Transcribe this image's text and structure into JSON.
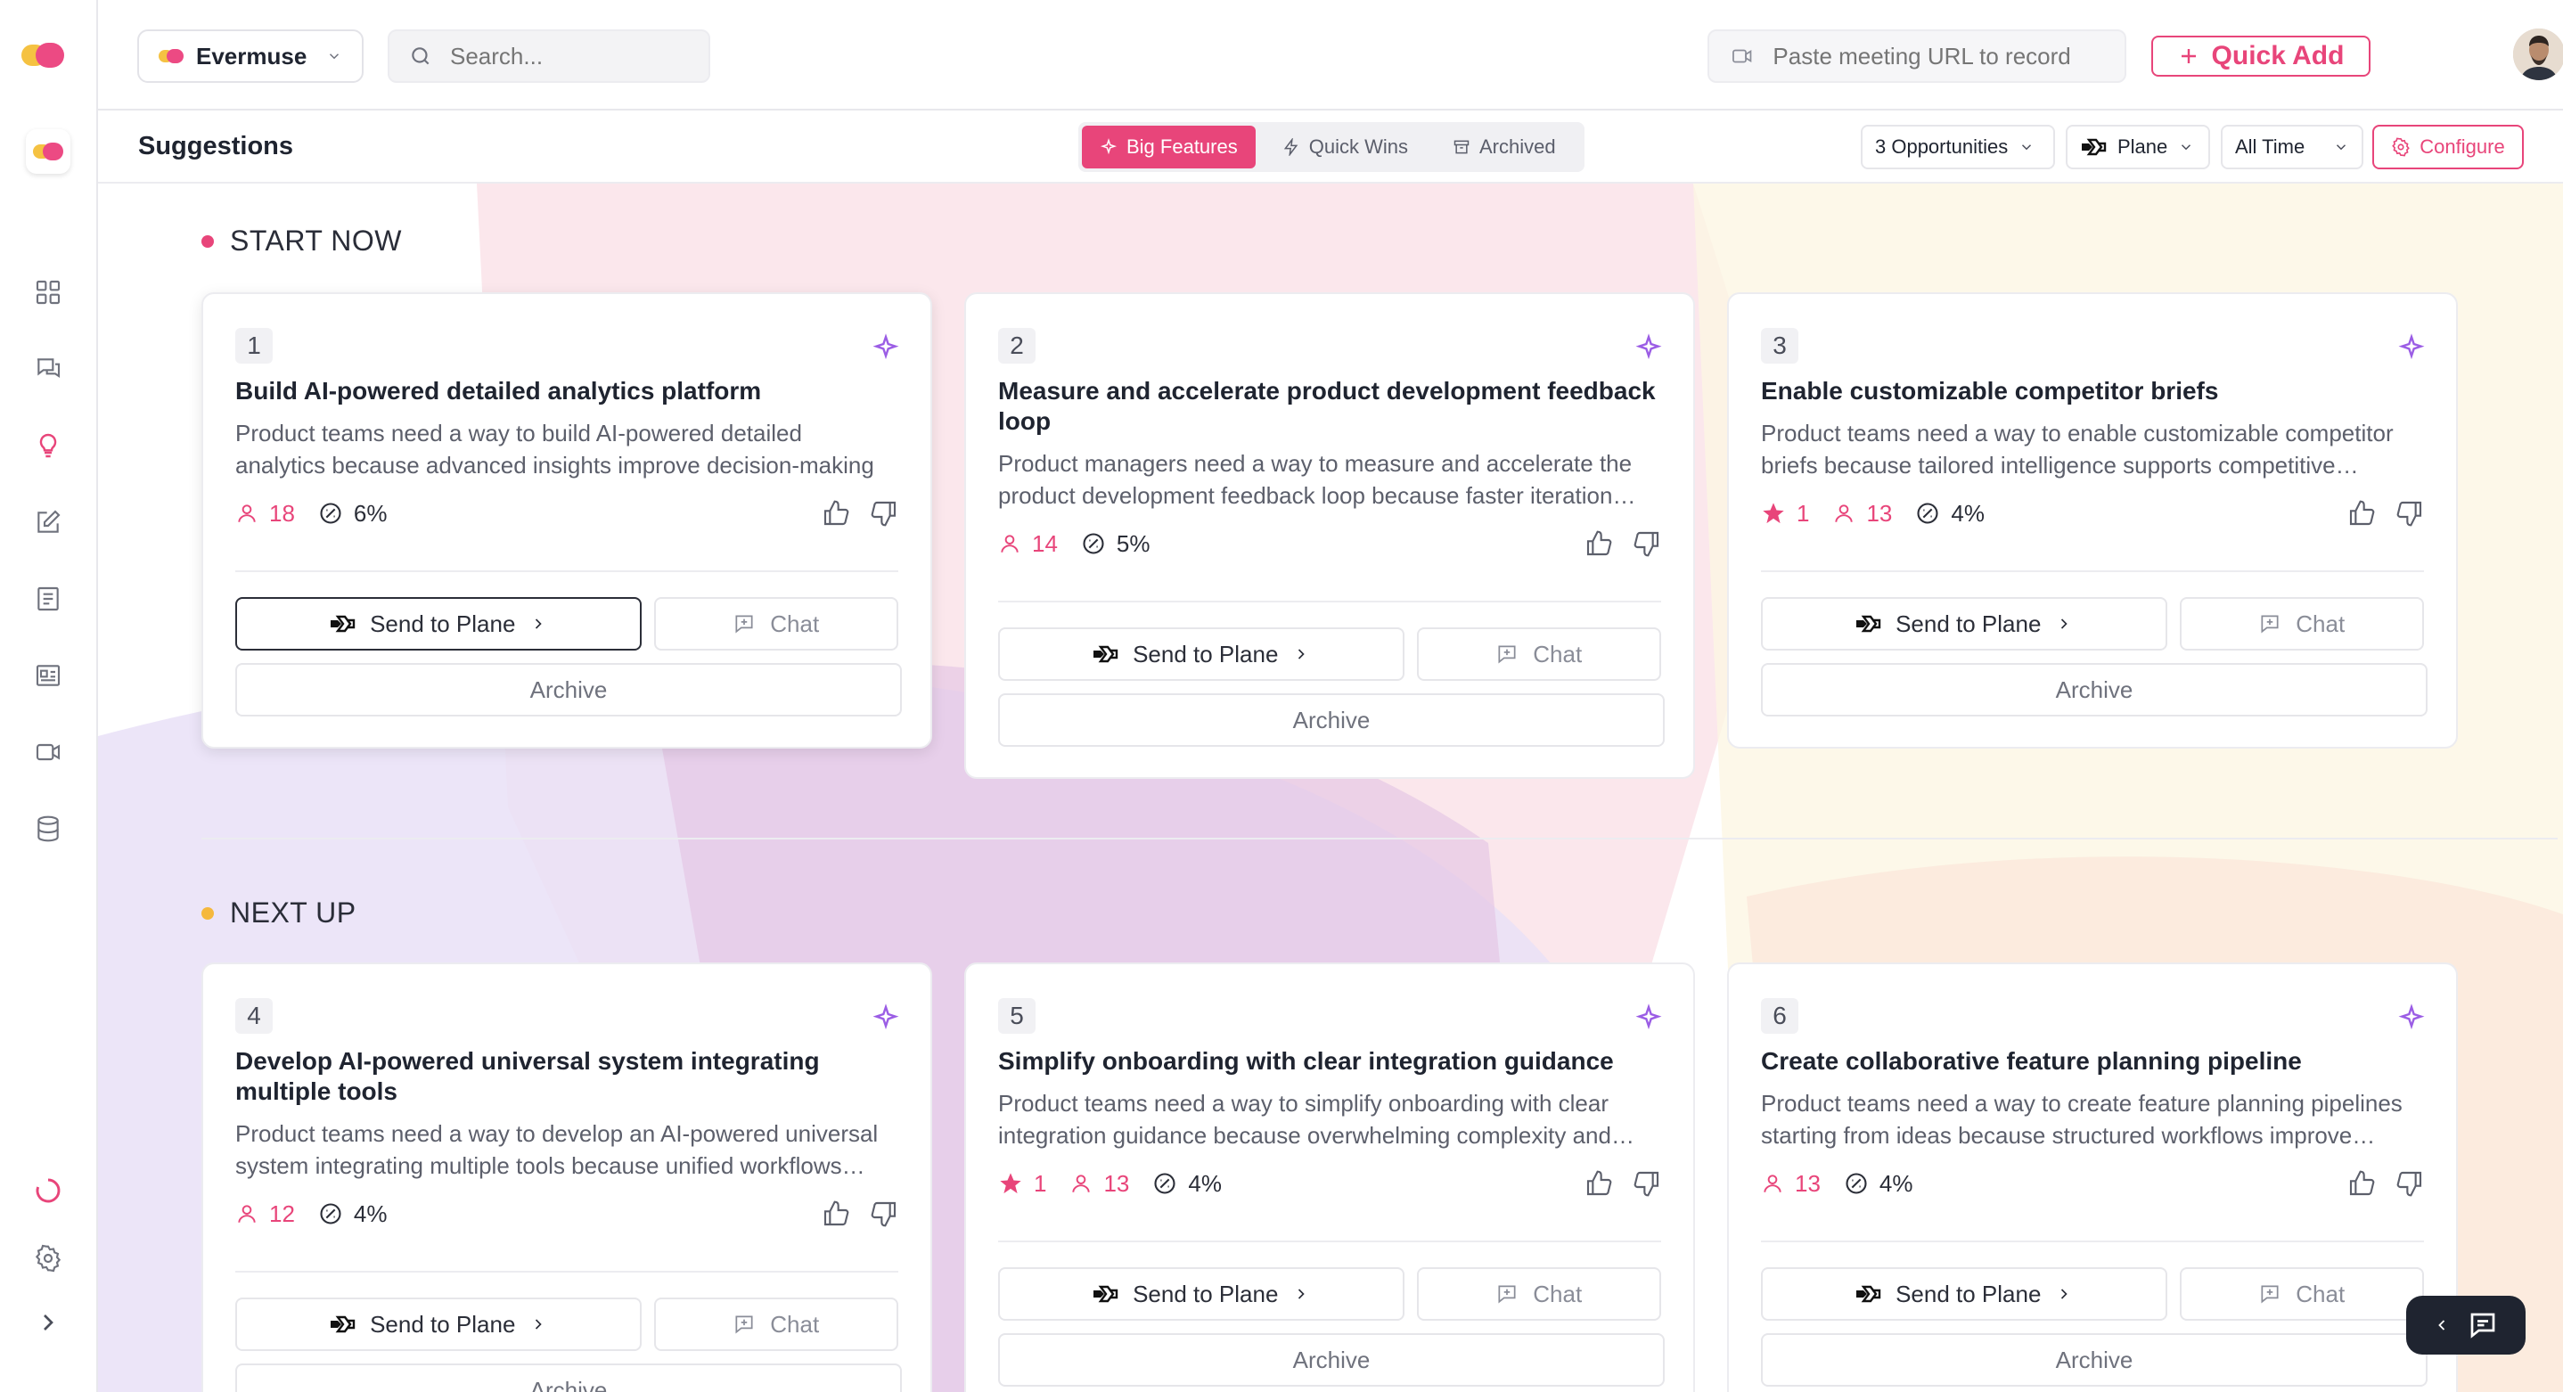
{
  "header": {
    "org_name": "Evermuse",
    "search_placeholder": "Search...",
    "meeting_placeholder": "Paste meeting URL to record",
    "quick_add_label": "Quick Add"
  },
  "subheader": {
    "title": "Suggestions",
    "tabs": [
      {
        "label": "Big Features",
        "active": true
      },
      {
        "label": "Quick Wins",
        "active": false
      },
      {
        "label": "Archived",
        "active": false
      }
    ],
    "filters": {
      "opportunities": "3 Opportunities",
      "integration": "Plane",
      "time_range": "All Time"
    },
    "configure_label": "Configure"
  },
  "sections": [
    {
      "label": "START NOW",
      "dot_color": "#e8457a"
    },
    {
      "label": "NEXT UP",
      "dot_color": "#f5b83d"
    }
  ],
  "colors": {
    "accent": "#e8457a",
    "star": "#e8457a",
    "sparkle": "#9b5de5"
  },
  "cards": [
    {
      "num": "1",
      "title": "Build AI-powered detailed analytics platform",
      "desc": "Product teams need a way to build AI-powered detailed analytics because advanced insights improve decision-making",
      "stars": "",
      "users": "18",
      "percent": "6%",
      "send_label": "Send to Plane",
      "chat_label": "Chat",
      "archive_label": "Archive"
    },
    {
      "num": "2",
      "title": "Measure and accelerate product development feedback loop",
      "desc": "Product managers need a way to measure and accelerate the product development feedback loop because faster iteration…",
      "stars": "",
      "users": "14",
      "percent": "5%",
      "send_label": "Send to Plane",
      "chat_label": "Chat",
      "archive_label": "Archive"
    },
    {
      "num": "3",
      "title": "Enable customizable competitor briefs",
      "desc": "Product teams need a way to enable customizable competitor briefs because tailored intelligence supports competitive…",
      "stars": "1",
      "users": "13",
      "percent": "4%",
      "send_label": "Send to Plane",
      "chat_label": "Chat",
      "archive_label": "Archive"
    },
    {
      "num": "4",
      "title": "Develop AI-powered universal system integrating multiple tools",
      "desc": "Product teams need a way to develop an AI-powered universal system integrating multiple tools because unified workflows…",
      "stars": "",
      "users": "12",
      "percent": "4%",
      "send_label": "Send to Plane",
      "chat_label": "Chat",
      "archive_label": "Archive"
    },
    {
      "num": "5",
      "title": "Simplify onboarding with clear integration guidance",
      "desc": "Product teams need a way to simplify onboarding with clear integration guidance because overwhelming complexity and…",
      "stars": "1",
      "users": "13",
      "percent": "4%",
      "send_label": "Send to Plane",
      "chat_label": "Chat",
      "archive_label": "Archive"
    },
    {
      "num": "6",
      "title": "Create collaborative feature planning pipeline",
      "desc": "Product teams need a way to create feature planning pipelines starting from ideas because structured workflows improve…",
      "stars": "",
      "users": "13",
      "percent": "4%",
      "send_label": "Send to Plane",
      "chat_label": "Chat",
      "archive_label": "Archive"
    }
  ]
}
